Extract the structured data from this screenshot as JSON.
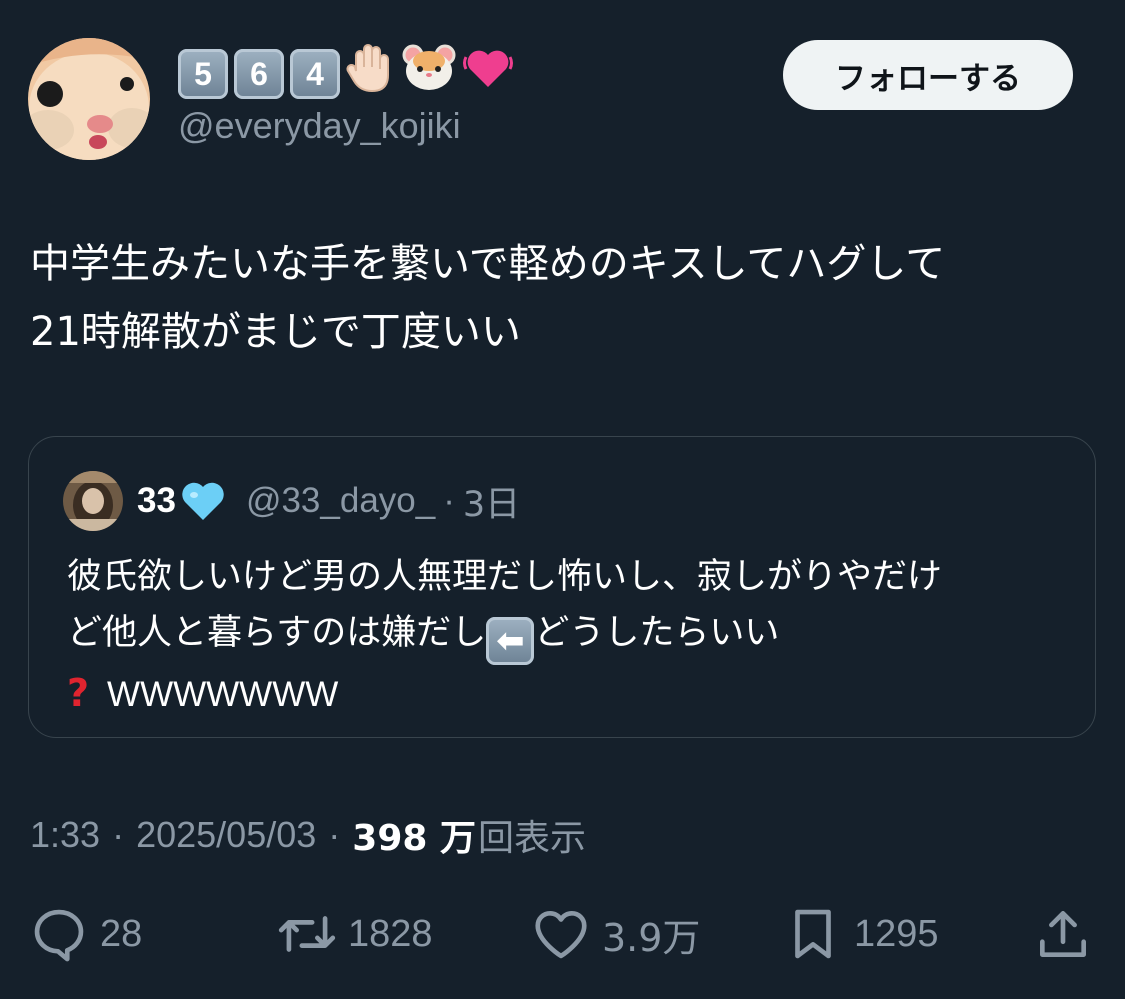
{
  "author": {
    "display_name_keycaps": [
      "5",
      "6",
      "4"
    ],
    "display_name_emoji": [
      "raised-hand",
      "hamster-face",
      "beating-heart"
    ],
    "handle": "@everyday_kojiki"
  },
  "follow_button": {
    "label": "フォローする"
  },
  "tweet": {
    "line1": "中学生みたいな手を繋いで軽めのキスしてハグして",
    "line2": "21時解散がまじで丁度いい"
  },
  "quote": {
    "name": "33",
    "name_emoji": "light-blue-heart",
    "handle": "@33_dayo_",
    "separator": "·",
    "time": "3日",
    "line1": "彼氏欲しいけど男の人無理だし怖いし、寂しがりやだけ",
    "line2_before": "ど他人と暮らすのは嫌だし",
    "arrow_emoji": "left-arrow",
    "line2_after": "どうしたらいい",
    "line3_emoji": "red-question-mark",
    "line3_text": "WWWWWWW"
  },
  "meta": {
    "time": "1:33",
    "separator": "·",
    "date": "2025/05/03",
    "views_count": "398 万",
    "views_label": "回表示"
  },
  "actions": {
    "replies": "28",
    "retweets": "1828",
    "likes": "3.9万",
    "bookmarks": "1295"
  },
  "colors": {
    "background": "#15202b",
    "secondary_text": "#8b98a5",
    "border": "#38444d",
    "follow_bg": "#eff3f4"
  }
}
